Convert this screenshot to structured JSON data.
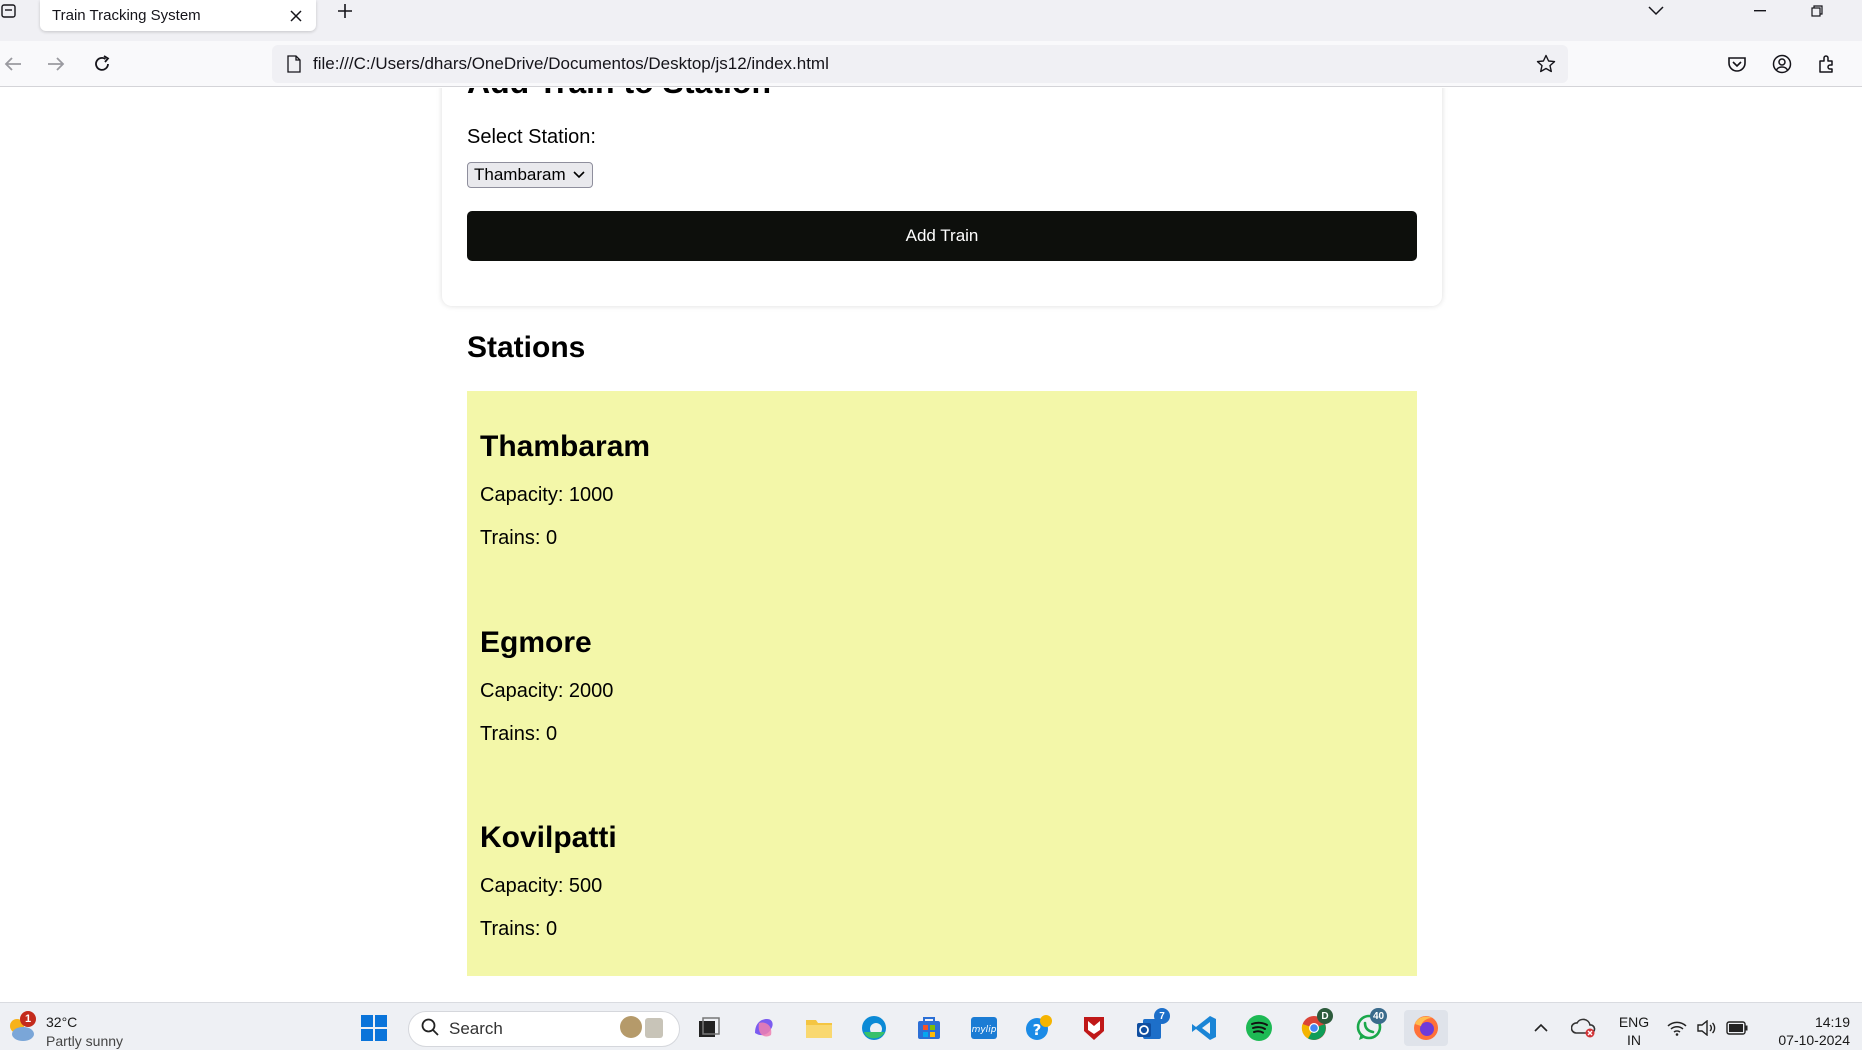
{
  "browser": {
    "tab_title": "Train Tracking System",
    "url": "file:///C:/Users/dhars/OneDrive/Documentos/Desktop/js12/index.html"
  },
  "form": {
    "heading": "Add Train to Station",
    "select_label": "Select Station:",
    "selected_station": "Thambaram",
    "button_label": "Add Train"
  },
  "stations": {
    "heading": "Stations",
    "items": [
      {
        "name": "Thambaram",
        "capacity": "Capacity: 1000",
        "trains": "Trains: 0"
      },
      {
        "name": "Egmore",
        "capacity": "Capacity: 2000",
        "trains": "Trains: 0"
      },
      {
        "name": "Kovilpatti",
        "capacity": "Capacity: 500",
        "trains": "Trains: 0"
      }
    ]
  },
  "taskbar": {
    "weather_temp": "32°C",
    "weather_desc": "Partly sunny",
    "weather_badge": "1",
    "search_placeholder": "Search",
    "outlook_badge": "7",
    "whatsapp_badge": "40",
    "chrome_badge": "D",
    "lang_top": "ENG",
    "lang_bottom": "IN",
    "time": "14:19",
    "date": "07-10-2024"
  },
  "colors": {
    "accent_button": "#0d0f0c",
    "station_bg": "#f3f7a9"
  }
}
